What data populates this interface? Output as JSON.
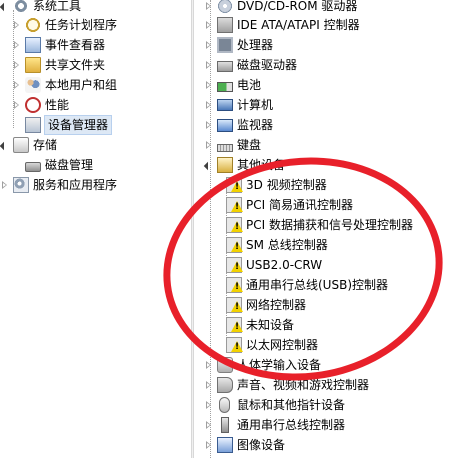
{
  "left_tree": {
    "items": [
      {
        "label": "系统工具",
        "icon": "gear-icon"
      },
      {
        "label": "任务计划程序",
        "icon": "clock-icon"
      },
      {
        "label": "事件查看器",
        "icon": "event-log-icon"
      },
      {
        "label": "共享文件夹",
        "icon": "shared-folder-icon"
      },
      {
        "label": "本地用户和组",
        "icon": "users-icon"
      },
      {
        "label": "性能",
        "icon": "performance-icon"
      },
      {
        "label": "设备管理器",
        "icon": "device-manager-icon"
      },
      {
        "label": "存储",
        "icon": "storage-icon"
      },
      {
        "label": "磁盘管理",
        "icon": "disk-management-icon"
      },
      {
        "label": "服务和应用程序",
        "icon": "services-icon"
      }
    ]
  },
  "device_tree": {
    "categories": [
      {
        "label": "DVD/CD-ROM 驱动器",
        "icon": "cd-drive-icon"
      },
      {
        "label": "IDE ATA/ATAPI 控制器",
        "icon": "ide-controller-icon"
      },
      {
        "label": "处理器",
        "icon": "processor-icon"
      },
      {
        "label": "磁盘驱动器",
        "icon": "disk-drive-icon"
      },
      {
        "label": "电池",
        "icon": "battery-icon"
      },
      {
        "label": "计算机",
        "icon": "computer-icon"
      },
      {
        "label": "监视器",
        "icon": "monitor-icon"
      },
      {
        "label": "键盘",
        "icon": "keyboard-icon"
      },
      {
        "label": "其他设备",
        "icon": "other-devices-icon"
      }
    ],
    "other_devices": [
      {
        "label": "3D 视频控制器"
      },
      {
        "label": "PCI 简易通讯控制器"
      },
      {
        "label": "PCI 数据捕获和信号处理控制器"
      },
      {
        "label": "SM 总线控制器"
      },
      {
        "label": "USB2.0-CRW"
      },
      {
        "label": "通用串行总线(USB)控制器"
      },
      {
        "label": "网络控制器"
      },
      {
        "label": "未知设备"
      },
      {
        "label": "以太网控制器"
      }
    ],
    "more_categories": [
      {
        "label": "人体学输入设备",
        "icon": "hid-icon"
      },
      {
        "label": "声音、视频和游戏控制器",
        "icon": "sound-icon"
      },
      {
        "label": "鼠标和其他指针设备",
        "icon": "mouse-icon"
      },
      {
        "label": "通用串行总线控制器",
        "icon": "usb-icon"
      },
      {
        "label": "图像设备",
        "icon": "imaging-device-icon"
      }
    ]
  },
  "colors": {
    "annotation_red": "#e8202a",
    "selection_bg": "#dde8f5",
    "warning_yellow": "#f2d200"
  }
}
